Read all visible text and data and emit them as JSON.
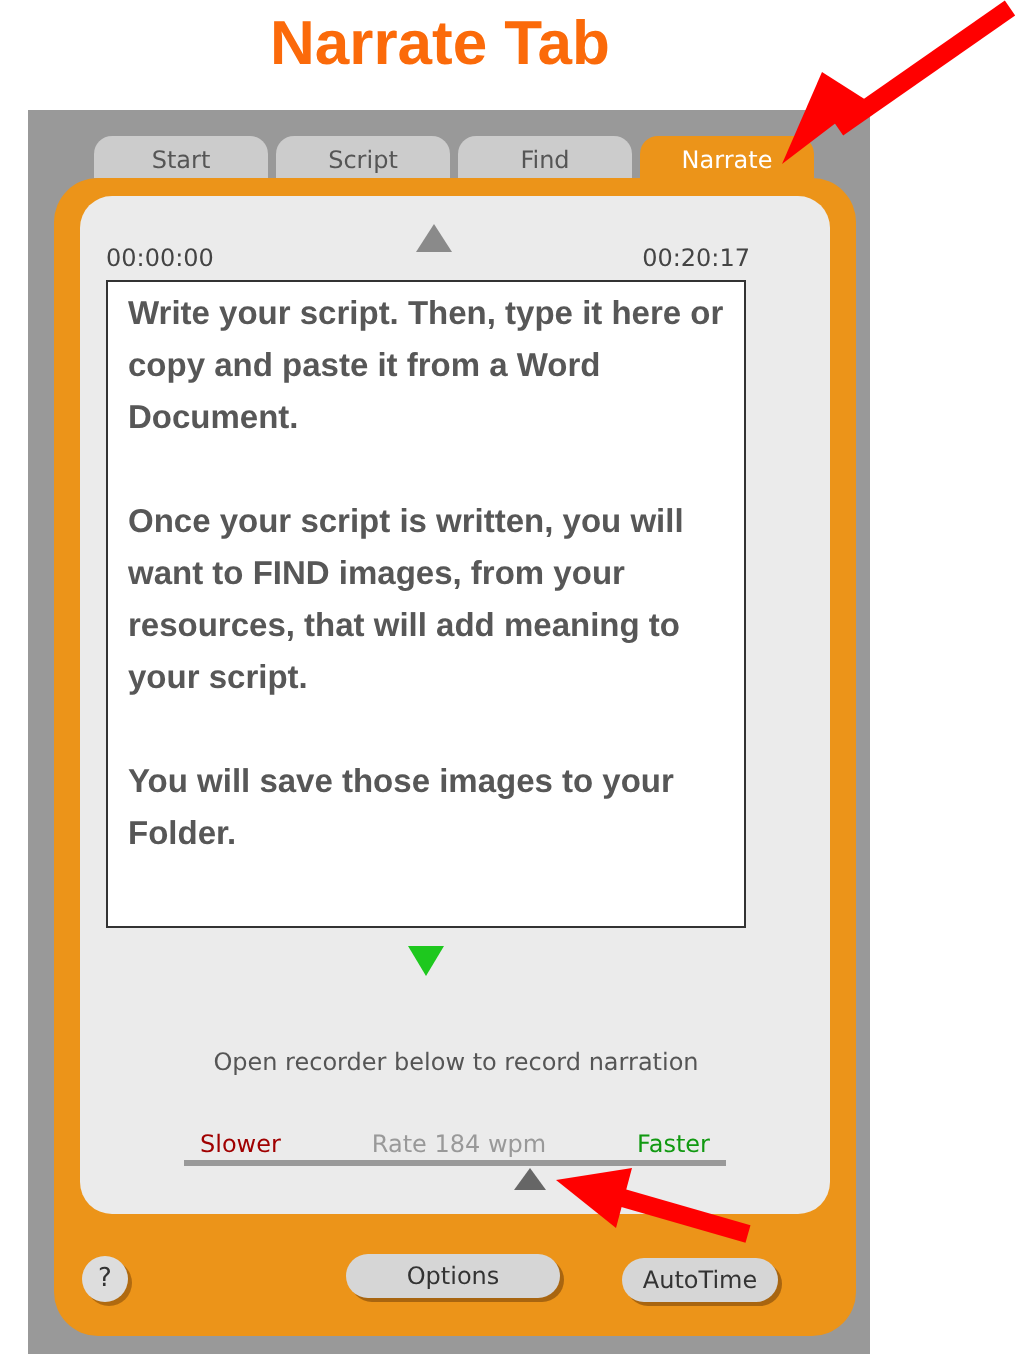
{
  "heading": "Narrate Tab",
  "tabs": [
    {
      "label": "Start",
      "selected": false
    },
    {
      "label": "Script",
      "selected": false
    },
    {
      "label": "Find",
      "selected": false
    },
    {
      "label": "Narrate",
      "selected": true
    }
  ],
  "timer": {
    "start": "00:00:00",
    "end": "00:20:17"
  },
  "script_paragraphs": [
    "Write your script. Then, type it here or copy and paste it from a Word Document.",
    "Once your script is written, you will want to FIND images, from your resources, that will add meaning to your script.",
    "You will save those images to your Folder."
  ],
  "hint": "Open recorder below to record narration",
  "rate": {
    "slower": "Slower",
    "reading": "Rate 184 wpm",
    "faster": "Faster",
    "level": 0.64
  },
  "buttons": {
    "help": "?",
    "options": "Options",
    "autotime": "AutoTime"
  }
}
